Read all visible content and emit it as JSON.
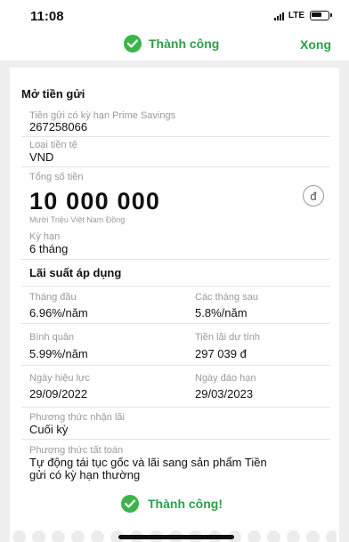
{
  "status_bar": {
    "time": "11:08",
    "network": "LTE"
  },
  "header": {
    "title": "Thành công",
    "done_label": "Xong",
    "accent_color": "#2e9e4a"
  },
  "receipt": {
    "section_title": "Mở tiền gửi",
    "account": {
      "label": "Tiền gửi có kỳ hạn Prime Savings",
      "value": "267258066"
    },
    "currency": {
      "label": "Loại tiền tệ",
      "value": "VND"
    },
    "amount": {
      "label": "Tổng số tiền",
      "value": "10 000 000",
      "words": "Mười Triệu  Việt Nam Đồng",
      "currency_symbol": "đ"
    },
    "term": {
      "label": "Kỳ hạn",
      "value": "6 tháng"
    },
    "rates": {
      "title": "Lãi suất áp dụng",
      "first_month": {
        "label": "Tháng đầu",
        "value": "6.96%/năm"
      },
      "following_months": {
        "label": "Các tháng sau",
        "value": "5.8%/năm"
      },
      "average": {
        "label": "Bình quân",
        "value": "5.99%/năm"
      },
      "expected_interest": {
        "label": "Tiền lãi dự tính",
        "value": "297 039 đ"
      },
      "effective_date": {
        "label": "Ngày hiệu lực",
        "value": "29/09/2022"
      },
      "maturity_date": {
        "label": "Ngày đáo hạn",
        "value": "29/03/2023"
      }
    },
    "interest_method": {
      "label": "Phương thức nhận lãi",
      "value": "Cuối kỳ"
    },
    "settlement_method": {
      "label": "Phương thức tất toán",
      "value_line1": "Tự động tái tục gốc và lãi sang sản phẩm Tiền",
      "value_line2": "gửi có kỳ hạn thường"
    }
  },
  "footer": {
    "status_text": "Thành công!"
  }
}
